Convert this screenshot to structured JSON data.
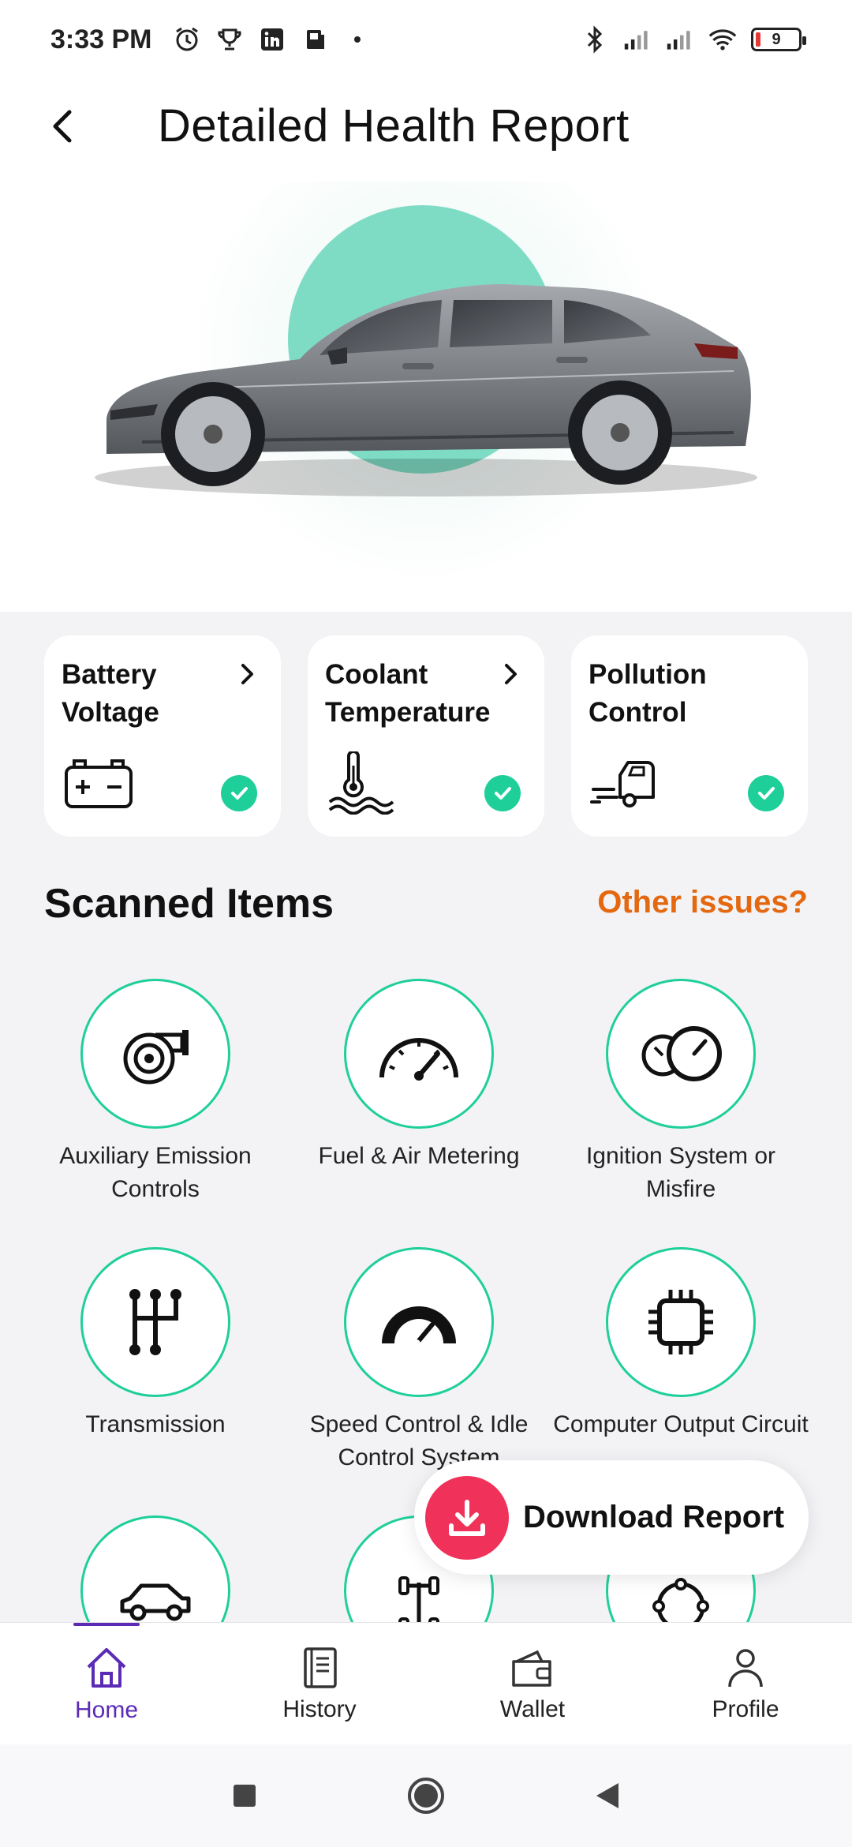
{
  "status_bar": {
    "time": "3:33 PM",
    "battery_level": "9"
  },
  "header": {
    "title": "Detailed Health Report"
  },
  "metrics": [
    {
      "title": "Battery Voltage",
      "icon": "car-battery-icon",
      "status": "ok",
      "has_chevron": true
    },
    {
      "title": "Coolant Temperature",
      "icon": "thermometer-icon",
      "status": "ok",
      "has_chevron": true
    },
    {
      "title": "Pollution Control",
      "icon": "exhaust-car-icon",
      "status": "ok",
      "has_chevron": false
    }
  ],
  "scanned": {
    "title": "Scanned Items",
    "other_issues": "Other issues?",
    "items": [
      {
        "label": "Auxiliary Emission Controls",
        "icon": "turbo-icon"
      },
      {
        "label": "Fuel & Air Metering",
        "icon": "speedometer-icon"
      },
      {
        "label": "Ignition System or Misfire",
        "icon": "gauges-icon"
      },
      {
        "label": "Transmission",
        "icon": "gear-shift-icon"
      },
      {
        "label": "Speed Control & Idle Control System",
        "icon": "speed-gauge-icon"
      },
      {
        "label": "Computer Output Circuit",
        "icon": "chip-icon"
      },
      {
        "label": "",
        "icon": "car-icon"
      },
      {
        "label": "",
        "icon": "chassis-icon"
      },
      {
        "label": "",
        "icon": "circuit-icon"
      }
    ]
  },
  "download": {
    "label": "Download Report"
  },
  "nav": {
    "items": [
      {
        "label": "Home",
        "icon": "home-icon",
        "active": true
      },
      {
        "label": "History",
        "icon": "book-icon",
        "active": false
      },
      {
        "label": "Wallet",
        "icon": "wallet-icon",
        "active": false
      },
      {
        "label": "Profile",
        "icon": "person-icon",
        "active": false
      }
    ]
  },
  "colors": {
    "accent_green": "#1fcf9a",
    "accent_orange": "#e4680f",
    "accent_red": "#f0325a",
    "nav_active": "#5b2bb5"
  }
}
